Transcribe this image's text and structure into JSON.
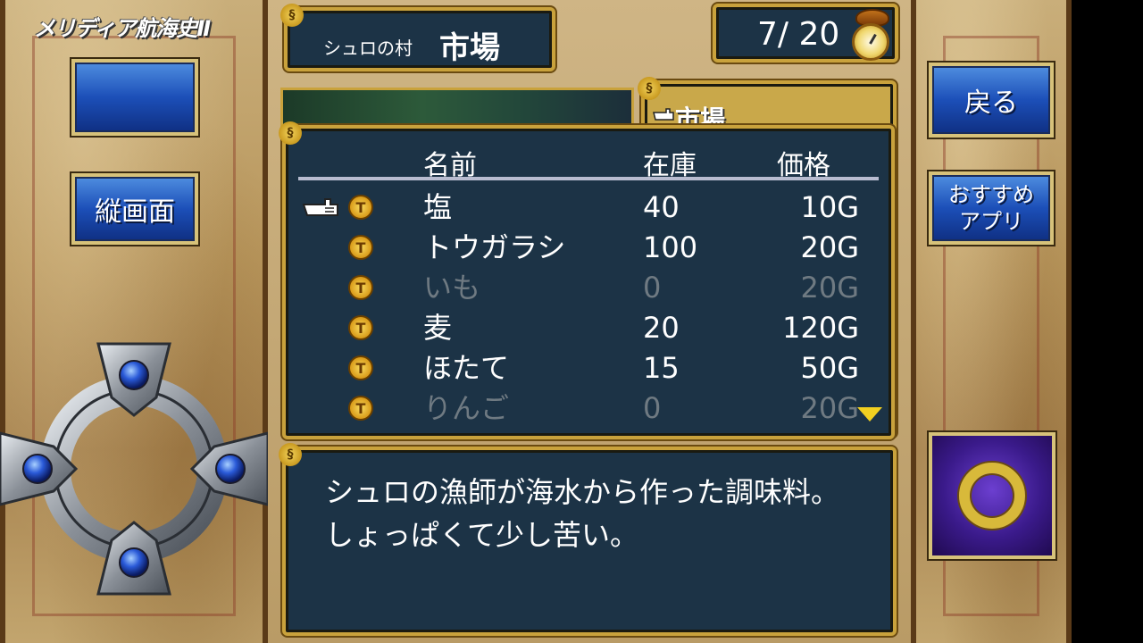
{
  "game": {
    "title": "メリディア航海史Ⅱ"
  },
  "left_panel": {
    "blank_button_label": "",
    "portrait_button_label": "縦画面"
  },
  "right_panel": {
    "back_button_label": "戻る",
    "recommend_button_label_1": "おすすめ",
    "recommend_button_label_2": "アプリ",
    "confirm_button_icon": "o-ring-icon"
  },
  "location": {
    "village": "シュロの村",
    "facility": "市場"
  },
  "days": {
    "display": "7/ 20",
    "icon": "pocket-watch-icon"
  },
  "side_menu": {
    "active_item": "市場"
  },
  "goods_table": {
    "headers": {
      "name": "名前",
      "stock": "在庫",
      "price": "価格"
    },
    "rows": [
      {
        "name": "塩",
        "stock": "40",
        "price": "10G",
        "available": true,
        "selected": true
      },
      {
        "name": "トウガラシ",
        "stock": "100",
        "price": "20G",
        "available": true,
        "selected": false
      },
      {
        "name": "いも",
        "stock": "0",
        "price": "20G",
        "available": false,
        "selected": false
      },
      {
        "name": "麦",
        "stock": "20",
        "price": "120G",
        "available": true,
        "selected": false
      },
      {
        "name": "ほたて",
        "stock": "15",
        "price": "50G",
        "available": true,
        "selected": false
      },
      {
        "name": "りんご",
        "stock": "0",
        "price": "20G",
        "available": false,
        "selected": false
      }
    ],
    "coin_icon_glyph": "T"
  },
  "description": {
    "line1": "シュロの漁師が海水から作った調味料。",
    "line2": "しょっぱくて少し苦い。"
  },
  "colors": {
    "panel_bg": "#1c3346",
    "panel_border": "#c9a23c",
    "disabled_text": "#6f7a82",
    "button_blue": "#1c4fb8"
  }
}
